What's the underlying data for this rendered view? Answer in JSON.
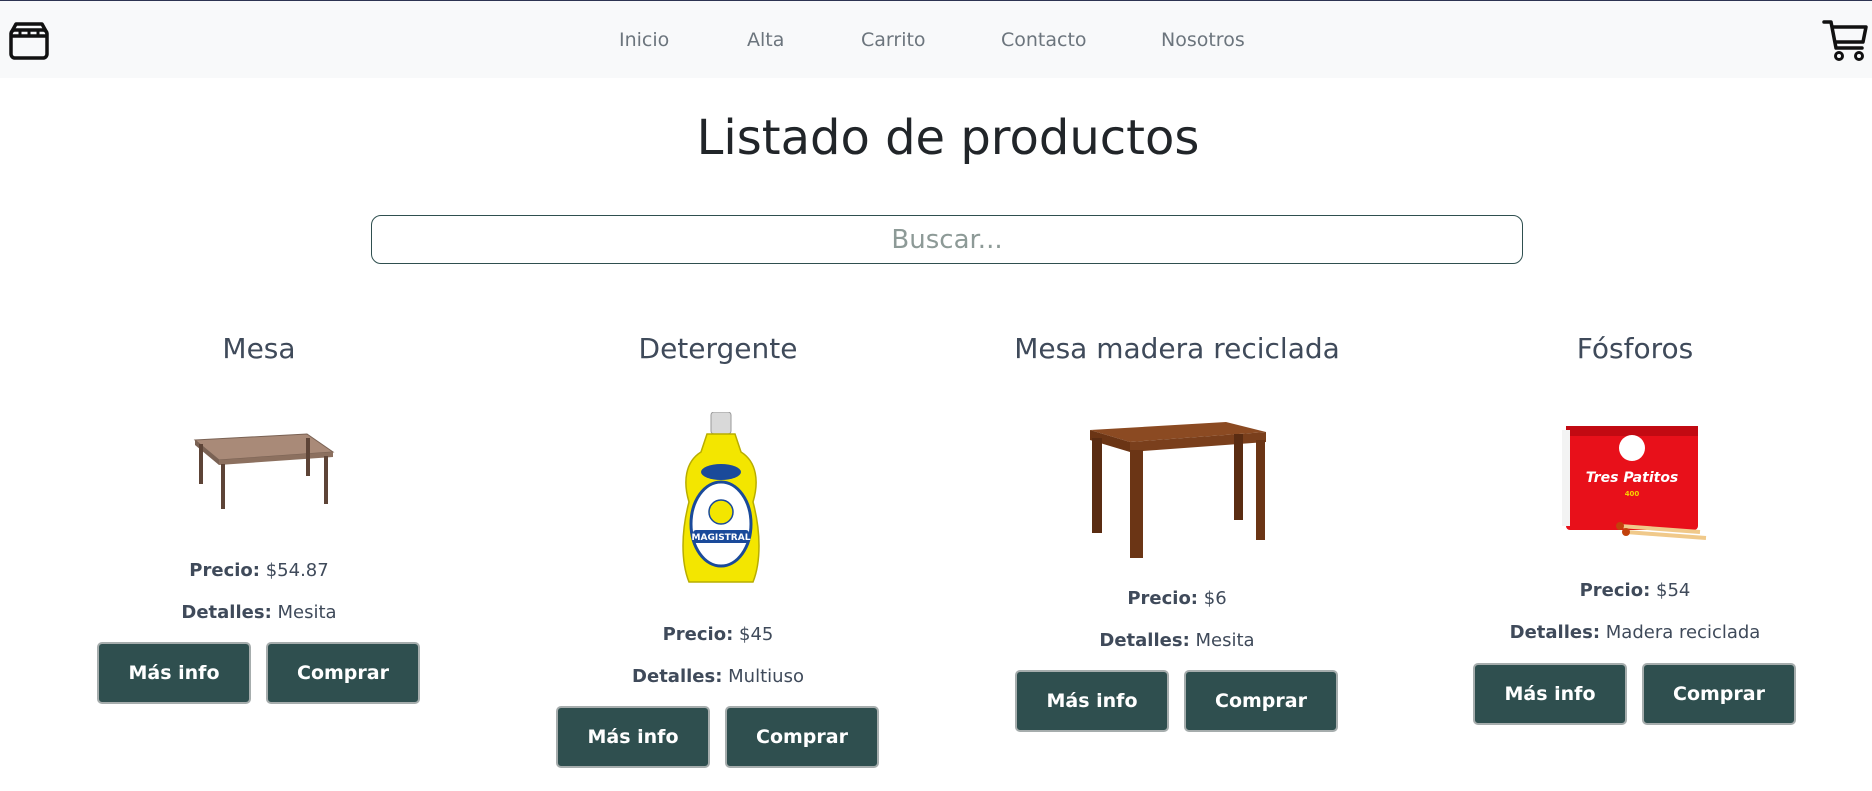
{
  "navbar": {
    "brand_icon": "store-icon",
    "cart_icon": "shopping-cart-icon",
    "links": [
      {
        "label": "Inicio"
      },
      {
        "label": "Alta"
      },
      {
        "label": "Carrito"
      },
      {
        "label": "Contacto"
      },
      {
        "label": "Nosotros"
      }
    ]
  },
  "page": {
    "title": "Listado de productos",
    "search_placeholder": "Buscar..."
  },
  "labels": {
    "price": "Precio:",
    "details": "Detalles:",
    "more_info": "Más info",
    "buy": "Comprar"
  },
  "products": [
    {
      "name": "Mesa",
      "price": "$54.87",
      "details": "Mesita",
      "image": "table-image"
    },
    {
      "name": "Detergente",
      "price": "$45",
      "details": "Multiuso",
      "image": "detergent-bottle-image"
    },
    {
      "name": "Mesa madera reciclada",
      "price": "$6",
      "details": "Mesita",
      "image": "wooden-table-image"
    },
    {
      "name": "Fósforos",
      "price": "$54",
      "details": "Madera reciclada",
      "image": "matchbox-image"
    }
  ],
  "images": {
    "detergent_logo": "MAGISTRAL",
    "matchbox_brand": "Tres Patitos",
    "matchbox_count": "400"
  },
  "colors": {
    "button_bg": "#2f4f4f",
    "navbar_bg": "#f8f9fa",
    "nav_link": "#6c757d",
    "card_text": "#3f4a5a"
  }
}
